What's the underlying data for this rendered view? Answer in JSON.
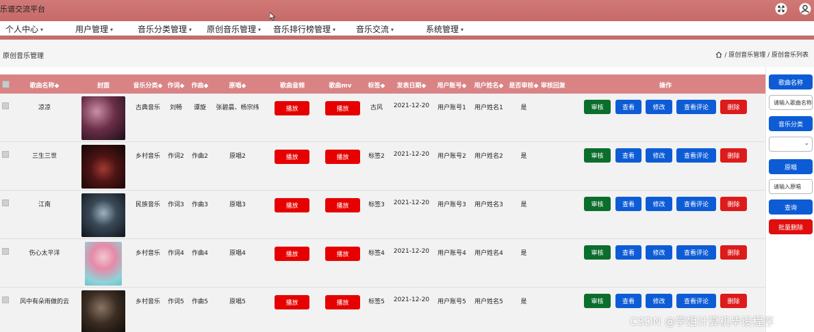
{
  "app": {
    "title": "乐谱交流平台"
  },
  "nav": [
    {
      "label": "个人中心",
      "caret": "▾"
    },
    {
      "label": "用户管理",
      "caret": "▾"
    },
    {
      "label": "音乐分类管理",
      "caret": "▾"
    },
    {
      "label": "原创音乐管理",
      "caret": "▾"
    },
    {
      "label": "音乐排行榜管理",
      "caret": "▾"
    },
    {
      "label": "音乐交流",
      "caret": "▾"
    },
    {
      "label": "系统管理",
      "caret": "▾"
    }
  ],
  "page": {
    "title": "原创音乐管理",
    "breadcrumb": "/ 原创音乐管理 / 原创音乐列表"
  },
  "table": {
    "headers": [
      "歌曲名称◆",
      "封面",
      "音乐分类◆",
      "作词◆",
      "作曲◆",
      "原唱◆",
      "歌曲音频",
      "歌曲mv",
      "标签◆",
      "发表日期◆",
      "用户账号◆",
      "用户姓名◆",
      "是否审核◆",
      "审核回复",
      "操作"
    ],
    "play_audio_label": "播放",
    "play_mv_label": "播放",
    "actions": {
      "approve": "审核",
      "view": "查看",
      "edit": "修改",
      "comments": "查看评论",
      "delete": "删除"
    },
    "rows": [
      {
        "name": "凉凉",
        "category": "古典音乐",
        "lyricist": "刘畅",
        "composer": "谭旋",
        "singer": "张碧晨、杨宗纬",
        "tag": "古风",
        "date": "2021-12-20",
        "account": "用户账号1",
        "username": "用户姓名1",
        "approved": "是",
        "reply": ""
      },
      {
        "name": "三生三世",
        "category": "乡村音乐",
        "lyricist": "作词2",
        "composer": "作曲2",
        "singer": "原唱2",
        "tag": "标签2",
        "date": "2021-12-20",
        "account": "用户账号2",
        "username": "用户姓名2",
        "approved": "是",
        "reply": ""
      },
      {
        "name": "江南",
        "category": "民族音乐",
        "lyricist": "作词3",
        "composer": "作曲3",
        "singer": "原唱3",
        "tag": "标签3",
        "date": "2021-12-20",
        "account": "用户账号3",
        "username": "用户姓名3",
        "approved": "是",
        "reply": ""
      },
      {
        "name": "伤心太平洋",
        "category": "乡村音乐",
        "lyricist": "作词4",
        "composer": "作曲4",
        "singer": "原唱4",
        "tag": "标签4",
        "date": "2021-12-20",
        "account": "用户账号4",
        "username": "用户姓名4",
        "approved": "是",
        "reply": ""
      },
      {
        "name": "风中有朵雨做的云",
        "category": "乡村音乐",
        "lyricist": "作词5",
        "composer": "作曲5",
        "singer": "原唱5",
        "tag": "标签5",
        "date": "2021-12-20",
        "account": "用户账号5",
        "username": "用户姓名5",
        "approved": "是",
        "reply": ""
      }
    ]
  },
  "sidebar": {
    "song_name_label": "歌曲名称",
    "song_name_placeholder": "请输入歌曲名称",
    "category_label": "音乐分类",
    "category_value": "",
    "singer_label": "原唱",
    "singer_placeholder": "请输入原唱",
    "query_label": "查询",
    "batch_delete_label": "批量删除"
  },
  "watermark": "CSDN @学姐计算机毕设程序",
  "colors": {
    "topbar": "#c66a68",
    "table_header": "#d98385",
    "play_button": "#e60000",
    "approve_button": "#0b6e2c",
    "action_button": "#0d5cd6",
    "delete_button": "#dc1b1b"
  }
}
